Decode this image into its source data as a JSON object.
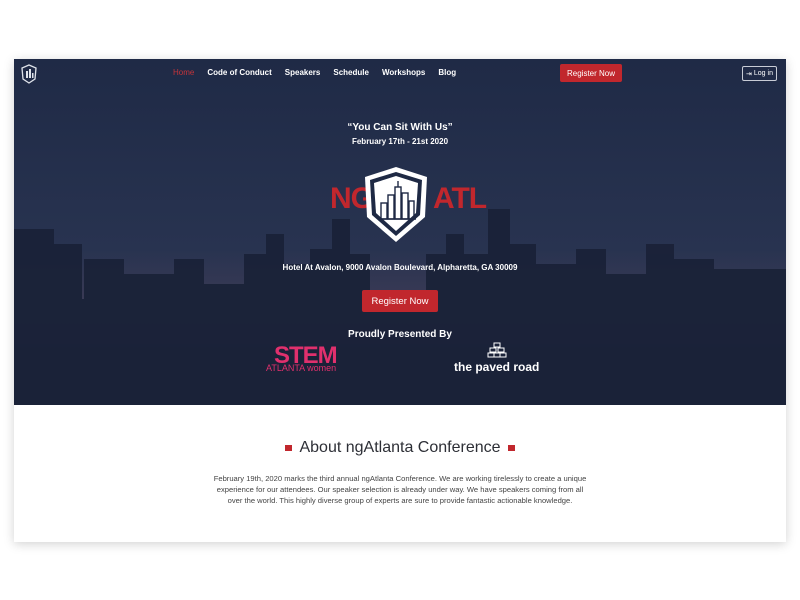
{
  "nav": {
    "items": [
      {
        "label": "Home",
        "active": true
      },
      {
        "label": "Code of Conduct",
        "active": false
      },
      {
        "label": "Speakers",
        "active": false
      },
      {
        "label": "Schedule",
        "active": false
      },
      {
        "label": "Workshops",
        "active": false
      },
      {
        "label": "Blog",
        "active": false
      }
    ],
    "register_label": "Register Now",
    "login_label": "Log in"
  },
  "hero": {
    "tagline": "“You Can Sit With Us”",
    "dates": "February 17th - 21st 2020",
    "logo_left": "NG",
    "logo_right": "ATL",
    "address": "Hotel At Avalon, 9000 Avalon Boulevard, Alpharetta, GA 30009",
    "register_label": "Register Now",
    "presented_by": "Proudly Presented By",
    "sponsors": {
      "stem_label": "STEM",
      "stem_sub": "ATLANTA women",
      "paved_label": "the paved road"
    }
  },
  "about": {
    "title": "About ngAtlanta Conference",
    "text": "February 19th, 2020 marks the third annual ngAtlanta Conference. We are working tirelessly to create a unique experience for our attendees. Our speaker selection is already under way. We have speakers coming from all over the world. This highly diverse group of experts are sure to provide fantastic actionable knowledge."
  },
  "colors": {
    "accent": "#c1272d",
    "hero_bg": "#1e2944",
    "stem_pink": "#e0306d"
  }
}
